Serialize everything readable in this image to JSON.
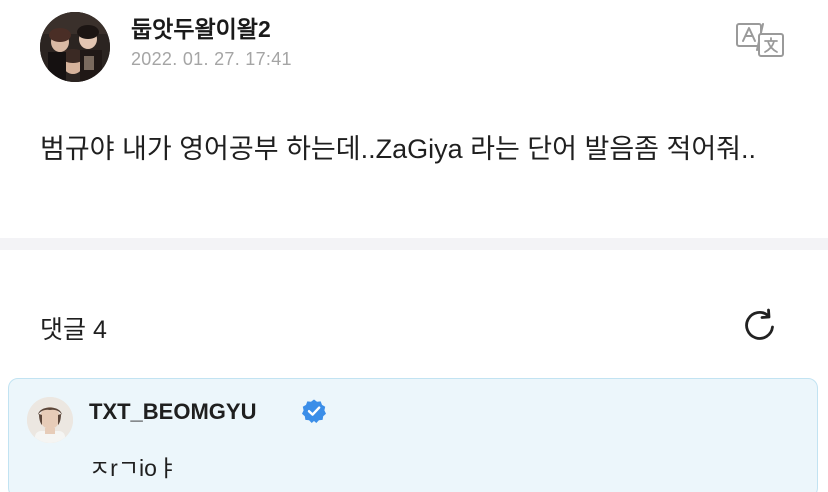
{
  "post": {
    "author": "둡앗두왈이왈2",
    "timestamp": "2022. 01. 27. 17:41",
    "body": "범규야 내가 영어공부 하는데..ZaGiya 라는 단어 발음좀 적어줘.."
  },
  "icons": {
    "translate": "translate-icon",
    "refresh": "refresh-icon",
    "verified": "verified-badge-icon"
  },
  "comments": {
    "header": "댓글 4",
    "highlighted": {
      "author": "TXT_BEOMGYU",
      "verified": true,
      "text": "ㅈrㄱioㅑ"
    }
  },
  "colors": {
    "highlight_background": "#ecf6fb",
    "highlight_border": "#c2e3f2",
    "verified_blue": "#3b8ee8",
    "timestamp_gray": "#a5a5a5"
  }
}
